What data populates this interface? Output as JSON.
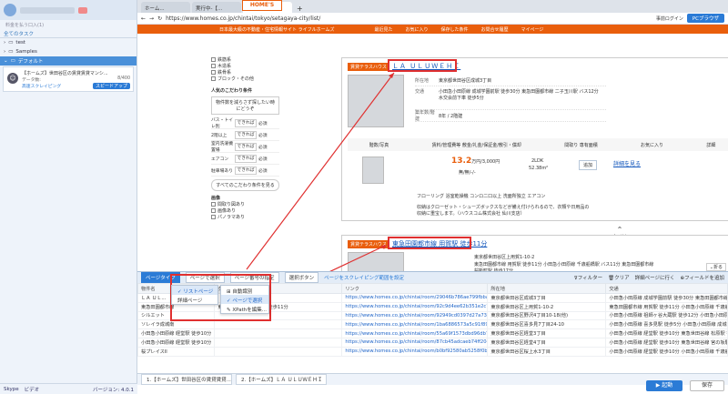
{
  "left": {
    "search_placeholder": "料金を払う口入(1)",
    "all_tasks": "全てのタスク",
    "items": [
      {
        "label": "test"
      },
      {
        "label": "Samples"
      },
      {
        "label": "デフォルト"
      }
    ],
    "task": {
      "title": "【ホームズ】世田谷区の賃貸賃貸マンシ...",
      "sub": "データ数:",
      "count": "8/400",
      "mode": "高速スクレイピング",
      "speed": "スピードアップ"
    },
    "footer": {
      "skype": "Skype",
      "mail": "ビデオ",
      "version": "バージョン: 4.0.1"
    }
  },
  "browser": {
    "tabs": [
      "ホーム...",
      "実行中-【...",
      "【ホーム..."
    ],
    "url": "https://www.homes.co.jp/chintai/tokyo/setagaya-city/list/",
    "login": "事前ログイン",
    "pc_browser": "PCブラウザ",
    "logo": "HOME'S",
    "nav": [
      "日本最大級の不動産・住宅情報サイト ライフルホームズ",
      "最近見た",
      "お気に入り",
      "保存した条件",
      "お問合せ履歴",
      "マイページ"
    ]
  },
  "sidebar": {
    "checks": [
      "鉄筋系",
      "木造系",
      "鉄骨系",
      "ブロック・その他"
    ],
    "popular": "人気のこだわり条件",
    "note": "物件数を減らさず探したい時にどうぞ",
    "rows": [
      {
        "l": "バス・トイレ別",
        "c": "できれば",
        "r": "必須"
      },
      {
        "l": "2階以上",
        "c": "できれば",
        "r": "必須"
      },
      {
        "l": "室内洗濯機置場",
        "c": "できれば",
        "r": "必須"
      },
      {
        "l": "エアコン",
        "c": "できれば",
        "r": "必須"
      },
      {
        "l": "駐車場あり",
        "c": "できれば",
        "r": "必須"
      }
    ],
    "all_btn": "すべてのこだわり条件を見る",
    "image": "画像",
    "image_checks": [
      "間取り図あり",
      "画像あり",
      "パノラマあり"
    ]
  },
  "card1": {
    "type": "賃貸テラスハウス",
    "title": "ＬＡ ＵＬＵＷＥＨＩ",
    "addr_k": "所在地",
    "addr": "東京都世田谷区成城3丁目",
    "traffic_k": "交通",
    "traffic": "小田急小田原線 成城学園前駅 徒歩30分 東急田園都市線 二子玉川駅 バス12分 水交会前下車 徒歩5分",
    "age_k": "築年数/階建",
    "age": "8年 / 2階建",
    "head": [
      "階数/写真",
      "賃料/管理費等 敷金/礼金/保証金/敷引・償却",
      "間取り 専有面積",
      "お気に入り",
      "詳細"
    ],
    "price": "13.2",
    "price_unit": "万円/3,000円",
    "deposit": "無/無/-/-",
    "layout": "2LDK",
    "area": "52.38m²",
    "fav": "追加",
    "detail": "詳細を見る",
    "features": "フローリング 浴室乾燥機 コンロ二口以上 洗面所独立 エアコン",
    "comment": "収納はクローゼット・シューズボックスなどが備え付けられるので、衣類や日用品の収納に重宝します。（ハウスコム株式会社 仙川支店）"
  },
  "card2": {
    "type": "賃貸テラスハウス",
    "title": "東急田園都市線 用賀駅 徒歩11分",
    "addr": "東京都世田谷区上用賀1-10-2",
    "traffic": "東急田園都市線 用賀駅 徒歩11分 小田急小田原線 千歳船橋駅 バス11分 東急田園都市線 桜新町駅 徒歩17分",
    "age": "10年 / 3階建"
  },
  "pagetop": "ページトップ",
  "tool": {
    "tabs_label": "ページタイプ",
    "select_label": "ページで選択",
    "page_num_label": "ページ番号の指定",
    "dropdown": "選択ボタン",
    "hint": "ページをスクレイピング範囲を設定",
    "filter": "フィルター",
    "clear": "クリア",
    "detail_page": "詳細ページに行く",
    "add_field": "フィールドを追加",
    "shrink": "折る",
    "menu1": [
      "リストページ",
      "詳細ページ"
    ],
    "menu2": [
      "自動識別",
      "ページで選択",
      "XPathを編集..."
    ],
    "columns": [
      "物件名",
      "タイトル",
      "リンク",
      "所在地",
      "交通"
    ],
    "rows": [
      [
        "ＬＡ ＵＬ...",
        "",
        "https://www.homes.co.jp/chintai/room/29046b786ae799fbbaa45c3a...",
        "東京都世田谷区成城3丁目",
        "小田急小田原線 成城学園前駅 徒歩30分 東急田園都市線 二子玉川"
      ],
      [
        "東急田園都市線",
        "東急田園都市線 真沢駅 徒歩11分",
        "https://www.homes.co.jp/chintai/room/92c9d4ee62b351e2c7582b9...",
        "東京都世田谷区上用賀1-10-2",
        "東急田園都市線 用賀駅 徒歩11分 小田急小田原線 千歳船橋駅"
      ],
      [
        "シルエット",
        "",
        "https://www.homes.co.jp/chintai/room/92949cd0397d27a7369914...",
        "東京都世田谷区野沢4丁目10-18(他)",
        "小田急小田原線 祖師ヶ谷大蔵駅 徒歩12分 小田急小田原線 成城学"
      ],
      [
        "ソレイラ成城南",
        "",
        "https://www.homes.co.jp/chintai/room/1ba6886573a5c91f89d2e42...",
        "東京都世田谷区喜多見7丁目24-10",
        "小田急小田原線 喜多見駅 徒歩5分 小田急小田原線 成城学園前駅"
      ],
      [
        "小田急小田原線 経堂駅 徒歩10分",
        "",
        "https://www.homes.co.jp/chintai/room/55a69f1573dbd96db796c0...",
        "東京都世田谷区経堂3丁目",
        "小田急小田原線 経堂駅 徒歩10分 東急世田谷線 松原駅 徒歩"
      ],
      [
        "小田急小田原線 経堂駅 徒歩10分",
        "",
        "https://www.homes.co.jp/chintai/room/87cb45adcaeb74ff204ad84...",
        "東京都世田谷区経堂4丁目",
        "小田急小田原線 経堂駅 徒歩10分 東急世田谷線 宮の坂駅 徒歩"
      ],
      [
        "桜プレイスII",
        "",
        "https://www.homes.co.jp/chintai/room/b0bf92580ab5258f0bc0b5...",
        "東京都世田谷区桜上水3丁目",
        "小田急小田原線 経堂駅 徒歩10分 小田急小田原線 千歳船橋駅"
      ]
    ]
  },
  "bottom": {
    "tabs": [
      "1.【ホームズ】世田谷区の賃貸賃貸...",
      "2.【ホームズ】ＬＡ ＵＬＵＷＥＨＩ"
    ],
    "run": "▶ 起動",
    "save": "保存"
  }
}
